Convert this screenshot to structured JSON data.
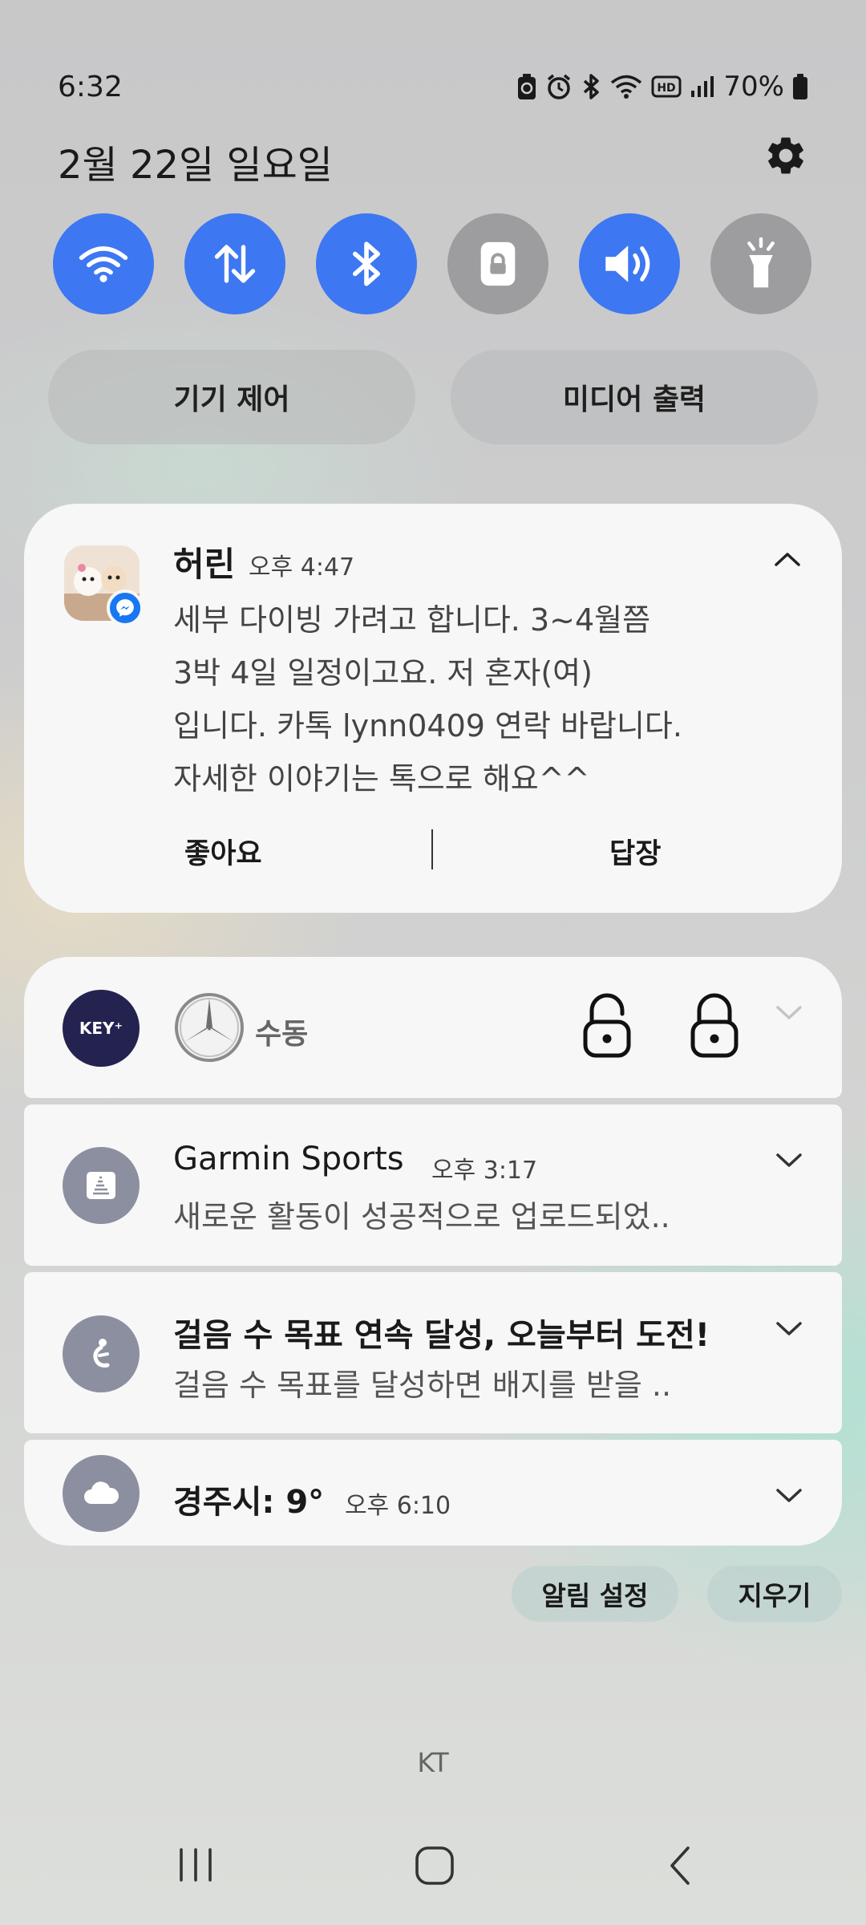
{
  "status_bar": {
    "time": "6:32",
    "battery": "70%",
    "icons": [
      "recycle-battery-icon",
      "alarm-icon",
      "bluetooth-icon",
      "wifi-icon",
      "hd-icon",
      "signal-icon",
      "battery-icon"
    ]
  },
  "header": {
    "date": "2월 22일 일요일",
    "settings_icon": "gear-icon"
  },
  "quick_toggles": [
    {
      "name": "wifi",
      "icon": "wifi-icon",
      "state": "on"
    },
    {
      "name": "mobile-data",
      "icon": "data-arrows-icon",
      "state": "on"
    },
    {
      "name": "bluetooth",
      "icon": "bluetooth-icon",
      "state": "on"
    },
    {
      "name": "rotation-lock",
      "icon": "lock-icon",
      "state": "off"
    },
    {
      "name": "sound",
      "icon": "speaker-icon",
      "state": "on"
    },
    {
      "name": "flashlight",
      "icon": "flashlight-icon",
      "state": "off"
    }
  ],
  "pills": {
    "device_control": "기기 제어",
    "media_output": "미디어 출력"
  },
  "message_notification": {
    "sender": "허린",
    "time": "오후 4:47",
    "body_lines": [
      "세부 다이빙 가려고 합니다.  3~4월쯤",
      "3박 4일 일정이고요. 저 혼자(여)",
      "입니다. 카톡 lynn0409 연락 바랍니다.",
      "자세한 이야기는 톡으로 해요^^"
    ],
    "actions": {
      "like": "좋아요",
      "reply": "답장"
    }
  },
  "notifications": {
    "keyplus": {
      "logo": "KEY⁺",
      "mode": "수동"
    },
    "garmin": {
      "title": "Garmin Sports",
      "time": "오후 3:17",
      "body": "새로운 활동이 성공적으로 업로드되었.."
    },
    "steps": {
      "title": "걸음 수 목표 연속 달성, 오늘부터 도전!",
      "body": "걸음 수 목표를 달성하면 배지를 받을 .."
    },
    "weather": {
      "title": "경주시: 9°",
      "time": "오후 6:10"
    }
  },
  "footer_actions": {
    "notification_settings": "알림 설정",
    "clear": "지우기"
  },
  "carrier": "KT",
  "colors": {
    "toggle_on": "#3d77f2",
    "toggle_off": "#9d9d9f",
    "messenger": "#1877f2",
    "keyplus_bg": "#24224f"
  }
}
